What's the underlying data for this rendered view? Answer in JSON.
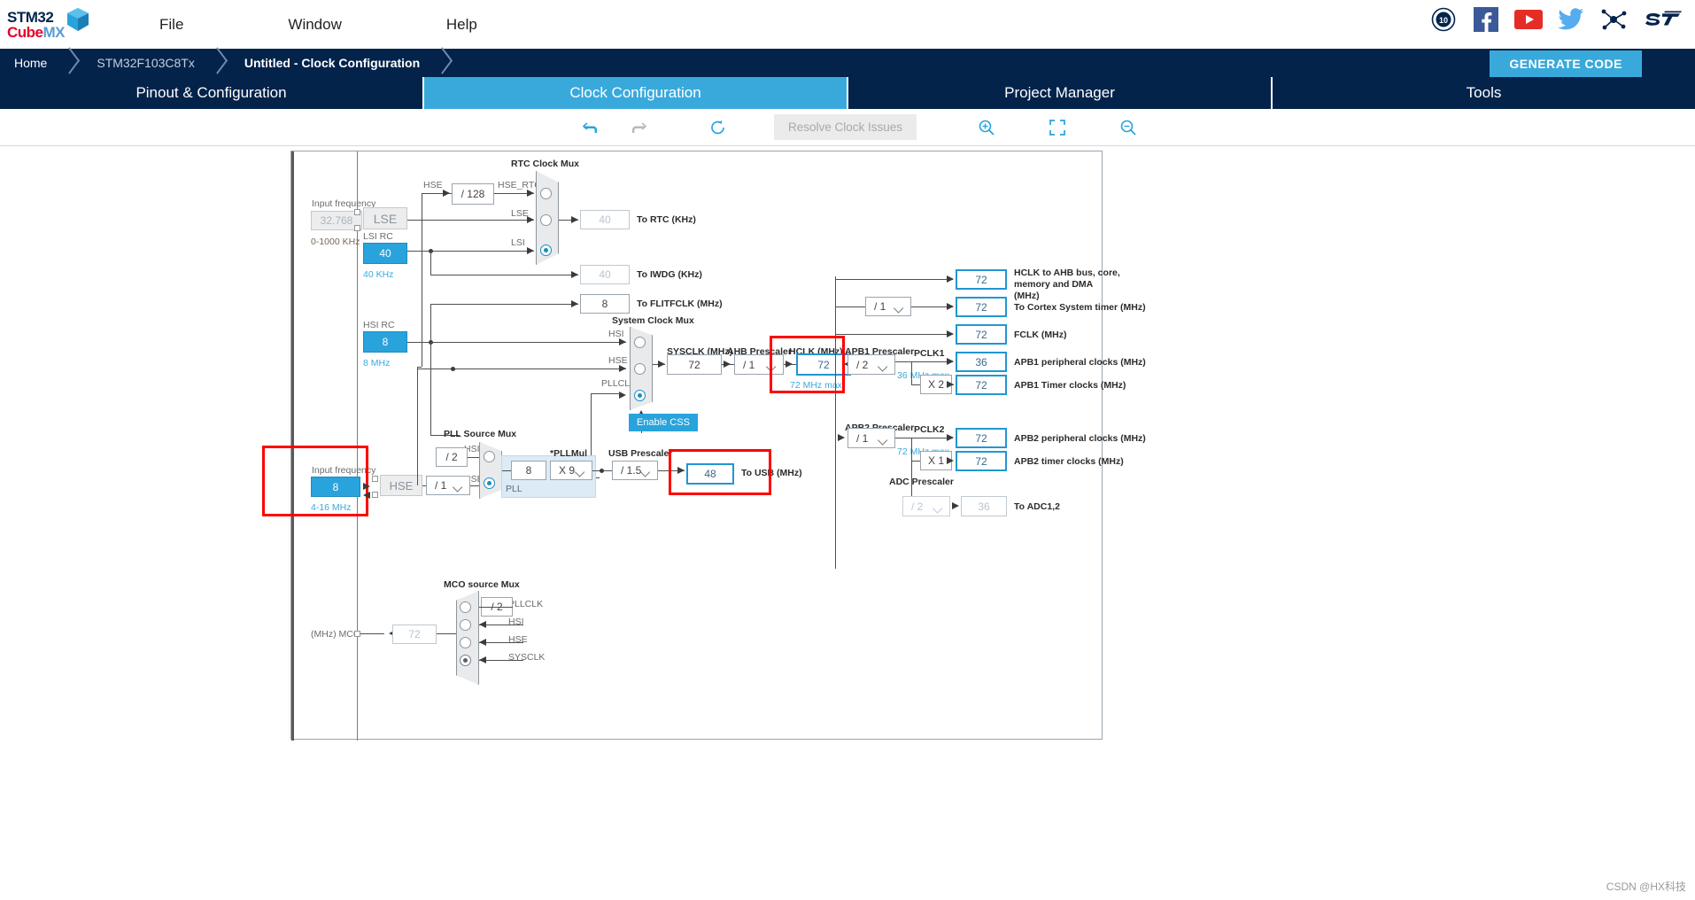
{
  "app": {
    "logo_line1": "STM32",
    "logo_line2_a": "Cube",
    "logo_line2_b": "MX"
  },
  "menu": {
    "items": [
      {
        "label": "File",
        "name": "menu-file"
      },
      {
        "label": "Window",
        "name": "menu-window"
      },
      {
        "label": "Help",
        "name": "menu-help"
      }
    ]
  },
  "top_icons": [
    {
      "name": "anniversary-10-icon",
      "label": "10"
    },
    {
      "name": "facebook-icon",
      "label": "f"
    },
    {
      "name": "youtube-icon",
      "label": "▶"
    },
    {
      "name": "twitter-icon",
      "label": "🐦"
    },
    {
      "name": "network-icon",
      "label": "✳"
    },
    {
      "name": "st-logo-icon",
      "label": "ST"
    }
  ],
  "breadcrumb": {
    "items": [
      "Home",
      "STM32F103C8Tx",
      "Untitled - Clock Configuration"
    ],
    "generate_code": "GENERATE CODE"
  },
  "tabs": [
    {
      "label": "Pinout & Configuration",
      "active": false
    },
    {
      "label": "Clock Configuration",
      "active": true
    },
    {
      "label": "Project Manager",
      "active": false
    },
    {
      "label": "Tools",
      "active": false
    }
  ],
  "toolbar": {
    "undo": "undo-icon",
    "redo": "redo-icon",
    "reset": "reset-icon",
    "resolve_label": "Resolve Clock Issues",
    "zoom_in": "zoom-in-icon",
    "fit": "fit-screen-icon",
    "zoom_out": "zoom-out-icon"
  },
  "clock": {
    "lse": {
      "input_frequency_label": "Input frequency",
      "value": "32.768",
      "range": "0-1000 KHz",
      "source_label": "LSE"
    },
    "lsi": {
      "label": "LSI RC",
      "value": "40",
      "unit": "40 KHz"
    },
    "hse_div128": "/ 128",
    "rtc_mux": {
      "title": "RTC Clock Mux",
      "inputs": [
        "HSE_RTC",
        "LSE",
        "LSI"
      ],
      "selected": "LSI"
    },
    "hse_sig_label": "HSE",
    "to_rtc": {
      "value": "40",
      "label": "To RTC (KHz)"
    },
    "to_iwdg": {
      "value": "40",
      "label": "To IWDG (KHz)"
    },
    "to_flitfclk": {
      "value": "8",
      "label": "To FLITFCLK (MHz)"
    },
    "hsi": {
      "label": "HSI RC",
      "value": "8",
      "unit": "8 MHz"
    },
    "hse_input": {
      "input_frequency_label": "Input frequency",
      "value": "8",
      "range": "4-16 MHz",
      "source_label": "HSE"
    },
    "sysclk_mux": {
      "title": "System Clock Mux",
      "inputs": [
        "HSI",
        "HSE",
        "PLLCLK"
      ],
      "selected": "PLLCLK"
    },
    "enable_css": "Enable CSS",
    "sysclk": {
      "label": "SYSCLK (MHz)",
      "value": "72"
    },
    "ahb_prescaler": {
      "label": "AHB Prescaler",
      "value": "/ 1"
    },
    "hclk": {
      "label": "HCLK (MHz)",
      "value": "72",
      "max": "72 MHz max"
    },
    "pll_source_mux": {
      "title": "PLL Source Mux",
      "inputs": [
        "HSI",
        "HSE"
      ],
      "selected": "HSE",
      "hsi_div2": "/ 2",
      "hse_div": "/ 1"
    },
    "pll": {
      "label": "PLL",
      "input_value": "8",
      "pllmul_label": "*PLLMul",
      "pllmul_value": "X 9"
    },
    "usb_prescaler": {
      "label": "USB Prescaler",
      "value": "/ 1.5"
    },
    "to_usb": {
      "value": "48",
      "label": "To USB (MHz)"
    },
    "cortex_prescaler": "/ 1",
    "outputs_ahb": [
      {
        "value": "72",
        "label": "HCLK to AHB bus, core,\nmemory and DMA (MHz)",
        "name": "hclk-ahb-output"
      },
      {
        "value": "72",
        "label": "To Cortex System timer (MHz)",
        "name": "cortex-systimer-output"
      },
      {
        "value": "72",
        "label": "FCLK (MHz)",
        "name": "fclk-output"
      }
    ],
    "apb1": {
      "prescaler_label": "APB1 Prescaler",
      "prescaler_value": "/ 2",
      "pclk_label": "PCLK1",
      "pclk_max": "36 MHz max",
      "mult": "X 2",
      "periph": {
        "value": "36",
        "label": "APB1 peripheral clocks (MHz)"
      },
      "timer": {
        "value": "72",
        "label": "APB1 Timer clocks (MHz)"
      }
    },
    "apb2": {
      "prescaler_label": "APB2 Prescaler",
      "prescaler_value": "/ 1",
      "pclk_label": "PCLK2",
      "pclk_max": "72 MHz max",
      "mult": "X 1",
      "periph": {
        "value": "72",
        "label": "APB2 peripheral clocks (MHz)"
      },
      "timer": {
        "value": "72",
        "label": "APB2 timer clocks (MHz)"
      }
    },
    "adc": {
      "prescaler_label": "ADC Prescaler",
      "prescaler_value": "/ 2",
      "value": "36",
      "label": "To ADC1,2"
    },
    "mco": {
      "title": "MCO source Mux",
      "label": "(MHz) MCO",
      "value": "72",
      "div2": "/ 2",
      "inputs": [
        "PLLCLK",
        "HSI",
        "HSE",
        "SYSCLK"
      ],
      "selected": "SYSCLK"
    }
  },
  "watermark": "CSDN @HX科技"
}
